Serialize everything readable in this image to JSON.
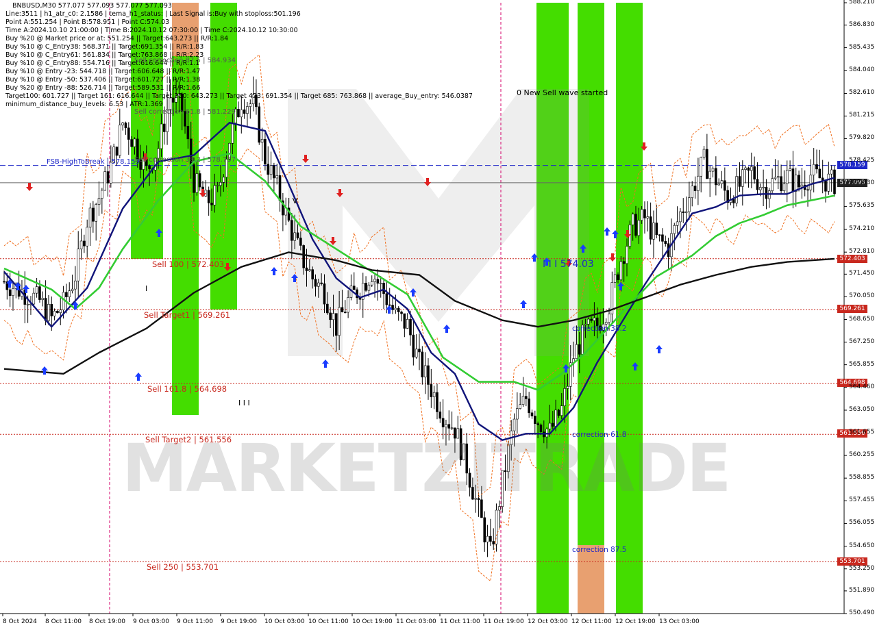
{
  "header": {
    "symbol": "BNBUSD,M30  577.077 577.093 577.077 577.093",
    "lines": [
      "Line:3511 | h1_atr_c0: 2.1586 | tema_h1_status: | Last Signal is:Buy with stoploss:501.196",
      "Point A:551.254 | Point B:578.951 | Point C:574.03",
      "Time A:2024.10.10 21:00:00 | Time B:2024.10.12 07:30:00 | Time C:2024.10.12 10:30:00",
      "Buy %20 @ Market price or at: 551.254 || Target:643.273 || R/R:1.84",
      "Buy %10 @ C_Entry38: 568.371 || Target:691.354 || R/R:1.83",
      "Buy %10 @ C_Entry61: 561.834 || Target:763.868 || R/R:2.23",
      "Buy %10 @ C_Entry88: 554.716 || Target:616.644 || R/R:1.1",
      "Buy %10 @ Entry -23: 544.718 || Target:606.648 || R/R:1.47",
      "Buy %10 @ Entry -50: 537.406 || Target:601.727 || R/R:1.38",
      "Buy %20 @ Entry -88: 526.714 || Target:589.531 || R/R:1.66",
      "Target100: 601.727 || Target 161: 616.644 || Target 250: 643.273 || Target 423: 691.354 || Target 685: 763.868 || average_Buy_entry: 546.0387",
      "minimum_distance_buy_levels: 6.53 | ATR:1.369"
    ]
  },
  "levels": {
    "sell_100": "Sell 100 | 572.403",
    "sell_target1": "Sell Target1 | 569.261",
    "sell_161": "Sell 161.8 | 564.698",
    "sell_target2": "Sell Target2 | 561.556",
    "sell_250": "Sell 250 | 553.701",
    "fsb": "FSB-HighToBreak | 578.159",
    "sell_corr_875": "Sell correction 87.5 | 584.934",
    "sell_corr_618": "Sell correction 61.8 | 581.229",
    "sell_corr_382": "Sell correction 38.2 | 578.737"
  },
  "annotations": {
    "new_sell_wave": "0 New Sell wave started",
    "wave_label": "I I I 574.03",
    "corr_382": "correction 38.2",
    "corr_618": "correction 61.8",
    "corr_875": "correction 87.5",
    "wave_iv": "I V",
    "wave_iii": "I I I",
    "wave_i": "I"
  },
  "price_tags": {
    "fsb": "578.159",
    "current": "577.093",
    "sell_100": "572.403",
    "target1": "569.261",
    "sell_161": "564.698",
    "target2": "561.556",
    "sell_250": "553.701"
  },
  "watermark": "MARKETZITRADE",
  "colors": {
    "green_zone": "#44dd00",
    "orange_zone": "#e8a070",
    "sell_level": "#c8281e",
    "fsb_line": "#1e28c8",
    "ema_fast": "#10147a",
    "ema_mid": "#33cc33",
    "ema_slow": "#111111",
    "buy_arrow": "#1a3cff",
    "sell_arrow": "#e02020"
  },
  "chart_data": {
    "type": "candlestick",
    "symbol": "BNBUSD",
    "timeframe": "M30",
    "ylim": [
      550.49,
      588.21
    ],
    "y_ticks": [
      "588.210",
      "586.830",
      "585.435",
      "584.040",
      "582.610",
      "581.215",
      "579.820",
      "578.425",
      "577.030",
      "575.635",
      "574.210",
      "572.810",
      "571.450",
      "570.050",
      "568.650",
      "567.250",
      "565.855",
      "564.460",
      "563.050",
      "561.655",
      "560.255",
      "558.855",
      "557.455",
      "556.055",
      "554.650",
      "553.250",
      "551.890",
      "550.490"
    ],
    "x_ticks": [
      "8 Oct 2024",
      "8 Oct 11:00",
      "8 Oct 19:00",
      "9 Oct 03:00",
      "9 Oct 11:00",
      "9 Oct 19:00",
      "10 Oct 03:00",
      "10 Oct 11:00",
      "10 Oct 19:00",
      "11 Oct 03:00",
      "11 Oct 11:00",
      "11 Oct 19:00",
      "12 Oct 03:00",
      "12 Oct 11:00",
      "12 Oct 19:00",
      "13 Oct 03:00"
    ],
    "horizontal_levels": [
      {
        "label": "FSB-HighToBreak",
        "value": 578.159
      },
      {
        "label": "current",
        "value": 577.093
      },
      {
        "label": "Sell 100",
        "value": 572.403
      },
      {
        "label": "Sell Target1",
        "value": 569.261
      },
      {
        "label": "Sell 161.8",
        "value": 564.698
      },
      {
        "label": "Sell Target2",
        "value": 561.556
      },
      {
        "label": "Sell 250",
        "value": 553.701
      }
    ],
    "price_path": [
      [
        0,
        571.0
      ],
      [
        3,
        570.4
      ],
      [
        6,
        569.8
      ],
      [
        8,
        568.7
      ],
      [
        10,
        569.6
      ],
      [
        12,
        571.4
      ],
      [
        14,
        574.8
      ],
      [
        16,
        576.2
      ],
      [
        18,
        578.1
      ],
      [
        20,
        580.8
      ],
      [
        22,
        579.6
      ],
      [
        24,
        577.8
      ],
      [
        26,
        579.3
      ],
      [
        28,
        582.4
      ],
      [
        30,
        581.6
      ],
      [
        32,
        577.2
      ],
      [
        34,
        575.9
      ],
      [
        36,
        576.4
      ],
      [
        38,
        579.8
      ],
      [
        40,
        582.2
      ],
      [
        42,
        581.9
      ],
      [
        44,
        578.6
      ],
      [
        46,
        576.8
      ],
      [
        48,
        574.6
      ],
      [
        50,
        572.6
      ],
      [
        52,
        571.2
      ],
      [
        54,
        570.4
      ],
      [
        56,
        568.2
      ],
      [
        58,
        569.8
      ],
      [
        60,
        570.6
      ],
      [
        62,
        571.6
      ],
      [
        64,
        570.3
      ],
      [
        66,
        568.9
      ],
      [
        68,
        568.3
      ],
      [
        70,
        565.9
      ],
      [
        72,
        564.4
      ],
      [
        74,
        562.8
      ],
      [
        76,
        561.9
      ],
      [
        78,
        559.6
      ],
      [
        80,
        556.8
      ],
      [
        82,
        554.2
      ],
      [
        84,
        558.6
      ],
      [
        86,
        562.4
      ],
      [
        88,
        563.8
      ],
      [
        90,
        562.4
      ],
      [
        92,
        561.7
      ],
      [
        94,
        563.1
      ],
      [
        96,
        566.4
      ],
      [
        98,
        567.9
      ],
      [
        100,
        568.3
      ],
      [
        102,
        569.6
      ],
      [
        104,
        572.4
      ],
      [
        106,
        574.4
      ],
      [
        108,
        574.9
      ],
      [
        110,
        573.6
      ],
      [
        112,
        573.1
      ],
      [
        114,
        575.2
      ],
      [
        116,
        576.7
      ],
      [
        118,
        578.4
      ],
      [
        120,
        577.3
      ],
      [
        122,
        576.3
      ],
      [
        124,
        576.9
      ],
      [
        126,
        577.8
      ],
      [
        128,
        576.8
      ],
      [
        130,
        577.2
      ],
      [
        132,
        577.5
      ],
      [
        134,
        576.9
      ],
      [
        136,
        577.6
      ],
      [
        138,
        577.3
      ],
      [
        140,
        577.1
      ]
    ],
    "series": [
      {
        "name": "EMA fast",
        "points": [
          [
            0,
            571.6
          ],
          [
            8,
            568.2
          ],
          [
            14,
            570.6
          ],
          [
            20,
            575.5
          ],
          [
            26,
            578.4
          ],
          [
            32,
            578.8
          ],
          [
            38,
            580.8
          ],
          [
            44,
            580.3
          ],
          [
            48,
            577.0
          ],
          [
            52,
            573.6
          ],
          [
            56,
            571.2
          ],
          [
            60,
            570.0
          ],
          [
            64,
            570.5
          ],
          [
            68,
            569.3
          ],
          [
            72,
            566.6
          ],
          [
            76,
            565.3
          ],
          [
            80,
            562.2
          ],
          [
            84,
            561.2
          ],
          [
            88,
            561.6
          ],
          [
            92,
            561.6
          ],
          [
            96,
            563.2
          ],
          [
            100,
            566.0
          ],
          [
            104,
            568.4
          ],
          [
            108,
            570.8
          ],
          [
            112,
            573.0
          ],
          [
            116,
            575.2
          ],
          [
            120,
            575.6
          ],
          [
            124,
            576.3
          ],
          [
            128,
            576.4
          ],
          [
            132,
            576.4
          ],
          [
            136,
            577.0
          ],
          [
            140,
            577.4
          ]
        ]
      },
      {
        "name": "EMA mid",
        "points": [
          [
            0,
            571.8
          ],
          [
            8,
            570.5
          ],
          [
            12,
            569.3
          ],
          [
            16,
            570.6
          ],
          [
            20,
            573.0
          ],
          [
            26,
            576.0
          ],
          [
            32,
            578.4
          ],
          [
            38,
            578.9
          ],
          [
            44,
            577.2
          ],
          [
            50,
            574.4
          ],
          [
            56,
            573.0
          ],
          [
            62,
            571.6
          ],
          [
            68,
            570.2
          ],
          [
            74,
            566.3
          ],
          [
            80,
            564.8
          ],
          [
            86,
            564.8
          ],
          [
            90,
            564.3
          ],
          [
            94,
            565.3
          ],
          [
            98,
            566.6
          ],
          [
            104,
            569.0
          ],
          [
            110,
            571.3
          ],
          [
            116,
            572.6
          ],
          [
            120,
            573.8
          ],
          [
            124,
            574.6
          ],
          [
            128,
            575.1
          ],
          [
            132,
            575.7
          ],
          [
            136,
            576.0
          ],
          [
            140,
            576.3
          ]
        ]
      },
      {
        "name": "SMA slow",
        "points": [
          [
            0,
            565.6
          ],
          [
            10,
            565.3
          ],
          [
            16,
            566.6
          ],
          [
            24,
            568.1
          ],
          [
            32,
            570.3
          ],
          [
            40,
            571.9
          ],
          [
            48,
            572.8
          ],
          [
            56,
            572.3
          ],
          [
            62,
            571.7
          ],
          [
            70,
            571.4
          ],
          [
            76,
            569.8
          ],
          [
            84,
            568.6
          ],
          [
            90,
            568.2
          ],
          [
            96,
            568.6
          ],
          [
            102,
            569.2
          ],
          [
            108,
            570.0
          ],
          [
            114,
            570.8
          ],
          [
            120,
            571.4
          ],
          [
            126,
            571.9
          ],
          [
            132,
            572.2
          ],
          [
            140,
            572.4
          ]
        ]
      }
    ]
  }
}
